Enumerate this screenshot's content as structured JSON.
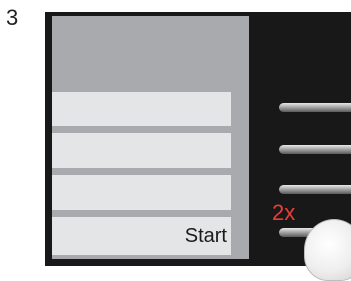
{
  "step": {
    "number": "3"
  },
  "menu": {
    "rows": [
      {
        "label": ""
      },
      {
        "label": ""
      },
      {
        "label": ""
      },
      {
        "label": "Start"
      }
    ]
  },
  "annotation": {
    "press_count": "2x"
  },
  "icons": {
    "pointer": "finger-press-icon"
  },
  "colors": {
    "device": "#181818",
    "screen": "#a8aaad",
    "menu_row": "#e4e5e6",
    "annotation": "#e2403a"
  }
}
